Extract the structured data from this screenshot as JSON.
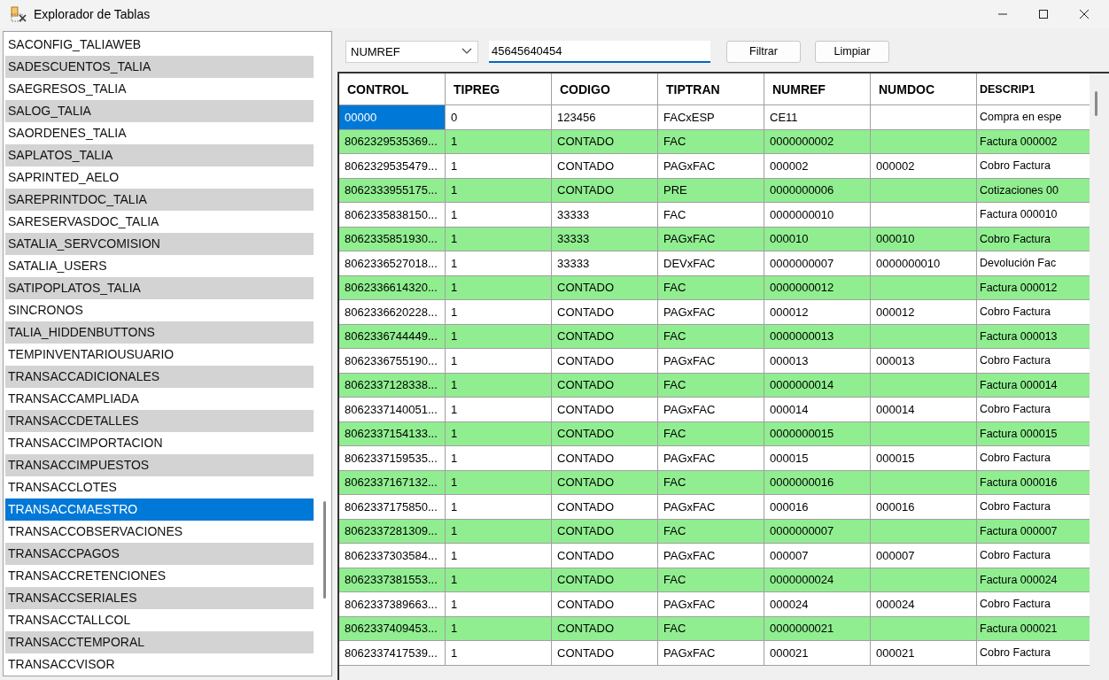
{
  "window": {
    "title": "Explorador de Tablas"
  },
  "table_list": {
    "items": [
      {
        "label": "SACONFIG_TALIAWEB",
        "selected": false
      },
      {
        "label": "SADESCUENTOS_TALIA",
        "selected": false
      },
      {
        "label": "SAEGRESOS_TALIA",
        "selected": false
      },
      {
        "label": "SALOG_TALIA",
        "selected": false
      },
      {
        "label": "SAORDENES_TALIA",
        "selected": false
      },
      {
        "label": "SAPLATOS_TALIA",
        "selected": false
      },
      {
        "label": "SAPRINTED_AELO",
        "selected": false
      },
      {
        "label": "SAREPRINTDOC_TALIA",
        "selected": false
      },
      {
        "label": "SARESERVASDOC_TALIA",
        "selected": false
      },
      {
        "label": "SATALIA_SERVCOMISION",
        "selected": false
      },
      {
        "label": "SATALIA_USERS",
        "selected": false
      },
      {
        "label": "SATIPOPLATOS_TALIA",
        "selected": false
      },
      {
        "label": "SINCRONOS",
        "selected": false
      },
      {
        "label": "TALIA_HIDDENBUTTONS",
        "selected": false
      },
      {
        "label": "TEMPINVENTARIOUSUARIO",
        "selected": false
      },
      {
        "label": "TRANSACCADICIONALES",
        "selected": false
      },
      {
        "label": "TRANSACCAMPLIADA",
        "selected": false
      },
      {
        "label": "TRANSACCDETALLES",
        "selected": false
      },
      {
        "label": "TRANSACCIMPORTACION",
        "selected": false
      },
      {
        "label": "TRANSACCIMPUESTOS",
        "selected": false
      },
      {
        "label": "TRANSACCLOTES",
        "selected": false
      },
      {
        "label": "TRANSACCMAESTRO",
        "selected": true
      },
      {
        "label": "TRANSACCOBSERVACIONES",
        "selected": false
      },
      {
        "label": "TRANSACCPAGOS",
        "selected": false
      },
      {
        "label": "TRANSACCRETENCIONES",
        "selected": false
      },
      {
        "label": "TRANSACCSERIALES",
        "selected": false
      },
      {
        "label": "TRANSACCTALLCOL",
        "selected": false
      },
      {
        "label": "TRANSACCTEMPORAL",
        "selected": false
      },
      {
        "label": "TRANSACCVISOR",
        "selected": false
      }
    ]
  },
  "filter": {
    "field": "NUMREF",
    "value": "45645640454",
    "buttons": [
      "Filtrar",
      "Limpiar"
    ]
  },
  "table": {
    "columns": [
      "CONTROL",
      "TIPREG",
      "CODIGO",
      "TIPTRAN",
      "NUMREF",
      "NUMDOC",
      "DESCRIP1"
    ],
    "rows": [
      {
        "highlighted": false,
        "selected": true,
        "cells": [
          "00000",
          "0",
          "123456",
          "FACxESP",
          "CE11",
          "",
          "Compra en espe"
        ]
      },
      {
        "highlighted": true,
        "selected": false,
        "cells": [
          "8062329535369...",
          "1",
          "CONTADO",
          "FAC",
          "0000000002",
          "",
          "Factura 000002"
        ]
      },
      {
        "highlighted": false,
        "selected": false,
        "cells": [
          "8062329535479...",
          "1",
          "CONTADO",
          "PAGxFAC",
          "000002",
          "000002",
          "Cobro Factura"
        ]
      },
      {
        "highlighted": true,
        "selected": false,
        "cells": [
          "8062333955175...",
          "1",
          "CONTADO",
          "PRE",
          "0000000006",
          "",
          "Cotizaciones 00"
        ]
      },
      {
        "highlighted": false,
        "selected": false,
        "cells": [
          "8062335838150...",
          "1",
          "33333",
          "FAC",
          "0000000010",
          "",
          "Factura 000010"
        ]
      },
      {
        "highlighted": true,
        "selected": false,
        "cells": [
          "8062335851930...",
          "1",
          "33333",
          "PAGxFAC",
          "000010",
          "000010",
          "Cobro Factura"
        ]
      },
      {
        "highlighted": false,
        "selected": false,
        "cells": [
          "8062336527018...",
          "1",
          "33333",
          "DEVxFAC",
          "0000000007",
          "0000000010",
          "Devolución Fac"
        ]
      },
      {
        "highlighted": true,
        "selected": false,
        "cells": [
          "8062336614320...",
          "1",
          "CONTADO",
          "FAC",
          "0000000012",
          "",
          "Factura 000012"
        ]
      },
      {
        "highlighted": false,
        "selected": false,
        "cells": [
          "8062336620228...",
          "1",
          "CONTADO",
          "PAGxFAC",
          "000012",
          "000012",
          "Cobro Factura"
        ]
      },
      {
        "highlighted": true,
        "selected": false,
        "cells": [
          "8062336744449...",
          "1",
          "CONTADO",
          "FAC",
          "0000000013",
          "",
          "Factura 000013"
        ]
      },
      {
        "highlighted": false,
        "selected": false,
        "cells": [
          "8062336755190...",
          "1",
          "CONTADO",
          "PAGxFAC",
          "000013",
          "000013",
          "Cobro Factura"
        ]
      },
      {
        "highlighted": true,
        "selected": false,
        "cells": [
          "8062337128338...",
          "1",
          "CONTADO",
          "FAC",
          "0000000014",
          "",
          "Factura 000014"
        ]
      },
      {
        "highlighted": false,
        "selected": false,
        "cells": [
          "8062337140051...",
          "1",
          "CONTADO",
          "PAGxFAC",
          "000014",
          "000014",
          "Cobro Factura"
        ]
      },
      {
        "highlighted": true,
        "selected": false,
        "cells": [
          "8062337154133...",
          "1",
          "CONTADO",
          "FAC",
          "0000000015",
          "",
          "Factura 000015"
        ]
      },
      {
        "highlighted": false,
        "selected": false,
        "cells": [
          "8062337159535...",
          "1",
          "CONTADO",
          "PAGxFAC",
          "000015",
          "000015",
          "Cobro Factura"
        ]
      },
      {
        "highlighted": true,
        "selected": false,
        "cells": [
          "8062337167132...",
          "1",
          "CONTADO",
          "FAC",
          "0000000016",
          "",
          "Factura 000016"
        ]
      },
      {
        "highlighted": false,
        "selected": false,
        "cells": [
          "8062337175850...",
          "1",
          "CONTADO",
          "PAGxFAC",
          "000016",
          "000016",
          "Cobro Factura"
        ]
      },
      {
        "highlighted": true,
        "selected": false,
        "cells": [
          "8062337281309...",
          "1",
          "CONTADO",
          "FAC",
          "0000000007",
          "",
          "Factura 000007"
        ]
      },
      {
        "highlighted": false,
        "selected": false,
        "cells": [
          "8062337303584...",
          "1",
          "CONTADO",
          "PAGxFAC",
          "000007",
          "000007",
          "Cobro Factura"
        ]
      },
      {
        "highlighted": true,
        "selected": false,
        "cells": [
          "8062337381553...",
          "1",
          "CONTADO",
          "FAC",
          "0000000024",
          "",
          "Factura 000024"
        ]
      },
      {
        "highlighted": false,
        "selected": false,
        "cells": [
          "8062337389663...",
          "1",
          "CONTADO",
          "PAGxFAC",
          "000024",
          "000024",
          "Cobro Factura"
        ]
      },
      {
        "highlighted": true,
        "selected": false,
        "cells": [
          "8062337409453...",
          "1",
          "CONTADO",
          "FAC",
          "0000000021",
          "",
          "Factura 000021"
        ]
      },
      {
        "highlighted": false,
        "selected": false,
        "cells": [
          "8062337417539...",
          "1",
          "CONTADO",
          "PAGxFAC",
          "000021",
          "000021",
          "Cobro Factura"
        ]
      }
    ]
  }
}
